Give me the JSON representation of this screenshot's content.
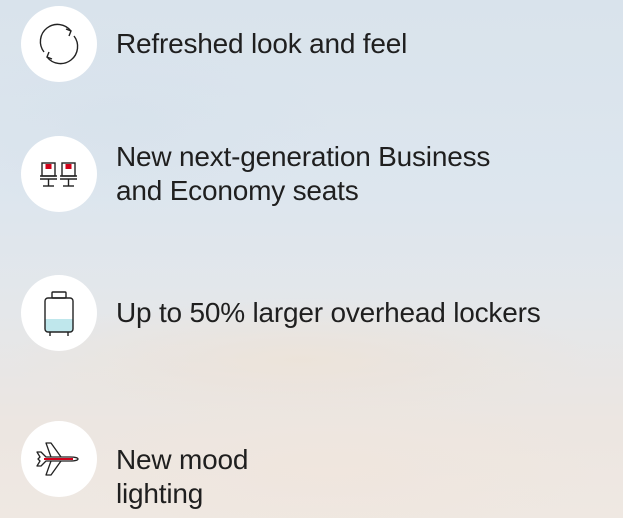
{
  "features": [
    {
      "icon": "refresh-icon",
      "text": "Refreshed look and feel"
    },
    {
      "icon": "seats-icon",
      "text": "New next-generation Business\nand Economy seats"
    },
    {
      "icon": "luggage-icon",
      "text": "Up to 50% larger overhead lockers"
    },
    {
      "icon": "airplane-icon",
      "text": "New mood\nlighting"
    }
  ],
  "colors": {
    "accent_red": "#d0021b",
    "locker_fill": "#bfe7ec",
    "icon_stroke": "#222222",
    "text": "#1f1f1f"
  }
}
